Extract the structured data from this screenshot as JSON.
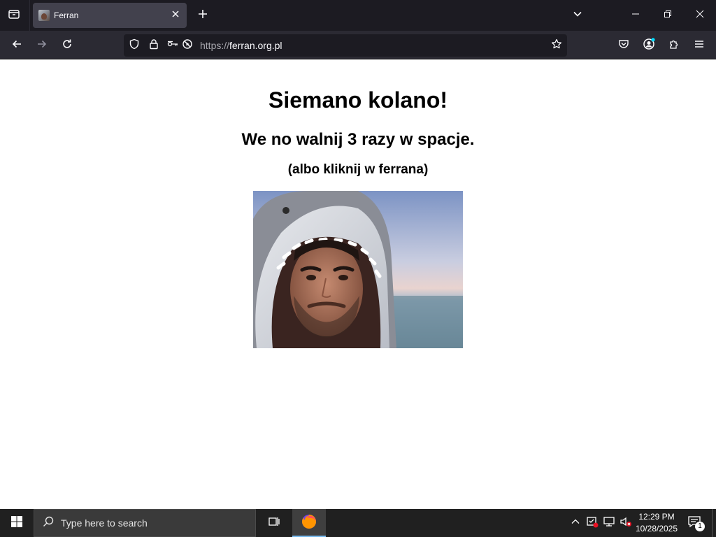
{
  "browser": {
    "tab": {
      "title": "Ferran",
      "favicon": "shark-photo-favicon"
    },
    "url": {
      "scheme": "https://",
      "host": "ferran.org.pl"
    },
    "icons": {
      "tab_list": "tab-list-icon",
      "close_tab": "close-icon",
      "new_tab": "plus-icon",
      "list_all_tabs": "chevron-down-icon",
      "back": "arrow-left-icon",
      "forward": "arrow-right-icon",
      "reload": "reload-icon",
      "tracking_protection": "shield-icon",
      "secure": "lock-icon",
      "permissions": "key-icon",
      "blocked_autoplay": "blocked-icon",
      "bookmark": "star-icon",
      "pocket": "pocket-icon",
      "account": "account-icon",
      "extensions": "puzzle-icon",
      "menu": "hamburger-icon"
    },
    "colors": {
      "tabbar": "#1c1b22",
      "toolbar": "#2b2a33",
      "selected_tab": "#42414d",
      "account_dot": "#00ddff"
    }
  },
  "page": {
    "heading": "Siemano kolano!",
    "subheading": "We no walnij 3 razy w spacje.",
    "hint": "(albo kliknij w ferrana)",
    "image": {
      "subject": "man-in-shark-costume-hood-at-beach"
    }
  },
  "taskbar": {
    "search_placeholder": "Type here to search",
    "time": "12:29 PM",
    "date": "10/28/2025",
    "notification_count": "1",
    "colors": {
      "background": "#202020",
      "active_indicator": "#76b9ed"
    }
  }
}
